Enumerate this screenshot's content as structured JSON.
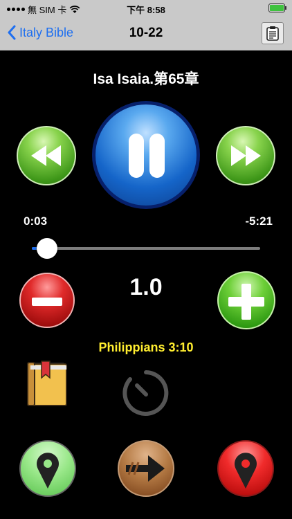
{
  "status_bar": {
    "carrier": "無 SIM 卡",
    "time": "下午 8:58",
    "battery_color": "#3ec23e"
  },
  "nav": {
    "back_label": "Italy Bible",
    "title": "10-22",
    "right_icon": "clipboard-icon"
  },
  "player": {
    "chapter_title": "Isa Isaia.第65章",
    "elapsed": "0:03",
    "remaining": "-5:21",
    "progress_fraction": 0.01,
    "state": "playing"
  },
  "speed": {
    "value": "1.0"
  },
  "verse": {
    "reference": "Philippians 3:10"
  },
  "icons": {
    "rewind": "rewind-icon",
    "pause": "pause-icon",
    "forward": "fast-forward-icon",
    "minus": "minus-icon",
    "plus": "plus-icon",
    "book": "bookmark-book-icon",
    "timer": "sleep-timer-icon",
    "pin_green": "map-pin-green-icon",
    "arrow": "forward-arrow-icon",
    "pin_red": "map-pin-red-icon"
  },
  "colors": {
    "accent": "#1e6ff0",
    "verse": "#ffed2f",
    "background": "#000000"
  }
}
